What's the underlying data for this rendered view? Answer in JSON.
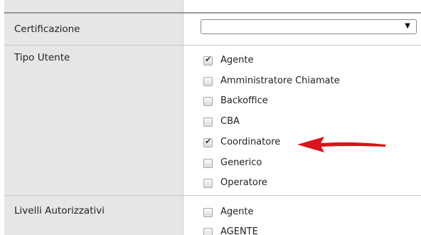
{
  "fields": {
    "certificazione": {
      "label": "Certificazione",
      "value": "",
      "caret": "▼"
    },
    "tipo_utente": {
      "label": "Tipo Utente",
      "options": [
        {
          "label": "Agente",
          "checked": true
        },
        {
          "label": "Amministratore Chiamate",
          "checked": false
        },
        {
          "label": "Backoffice",
          "checked": false
        },
        {
          "label": "CBA",
          "checked": false
        },
        {
          "label": "Coordinatore",
          "checked": true
        },
        {
          "label": "Generico",
          "checked": false
        },
        {
          "label": "Operatore",
          "checked": false
        }
      ]
    },
    "livelli_autorizzativi": {
      "label": "Livelli Autorizzativi",
      "options": [
        {
          "label": "Agente",
          "checked": false
        },
        {
          "label": "AGENTE",
          "checked": false
        }
      ]
    }
  },
  "annotation": {
    "arrow_color": "#d9141a",
    "points_to": "Coordinatore"
  },
  "icons": {
    "checkmark": "✔",
    "dropdown": "chevron-down-icon"
  }
}
